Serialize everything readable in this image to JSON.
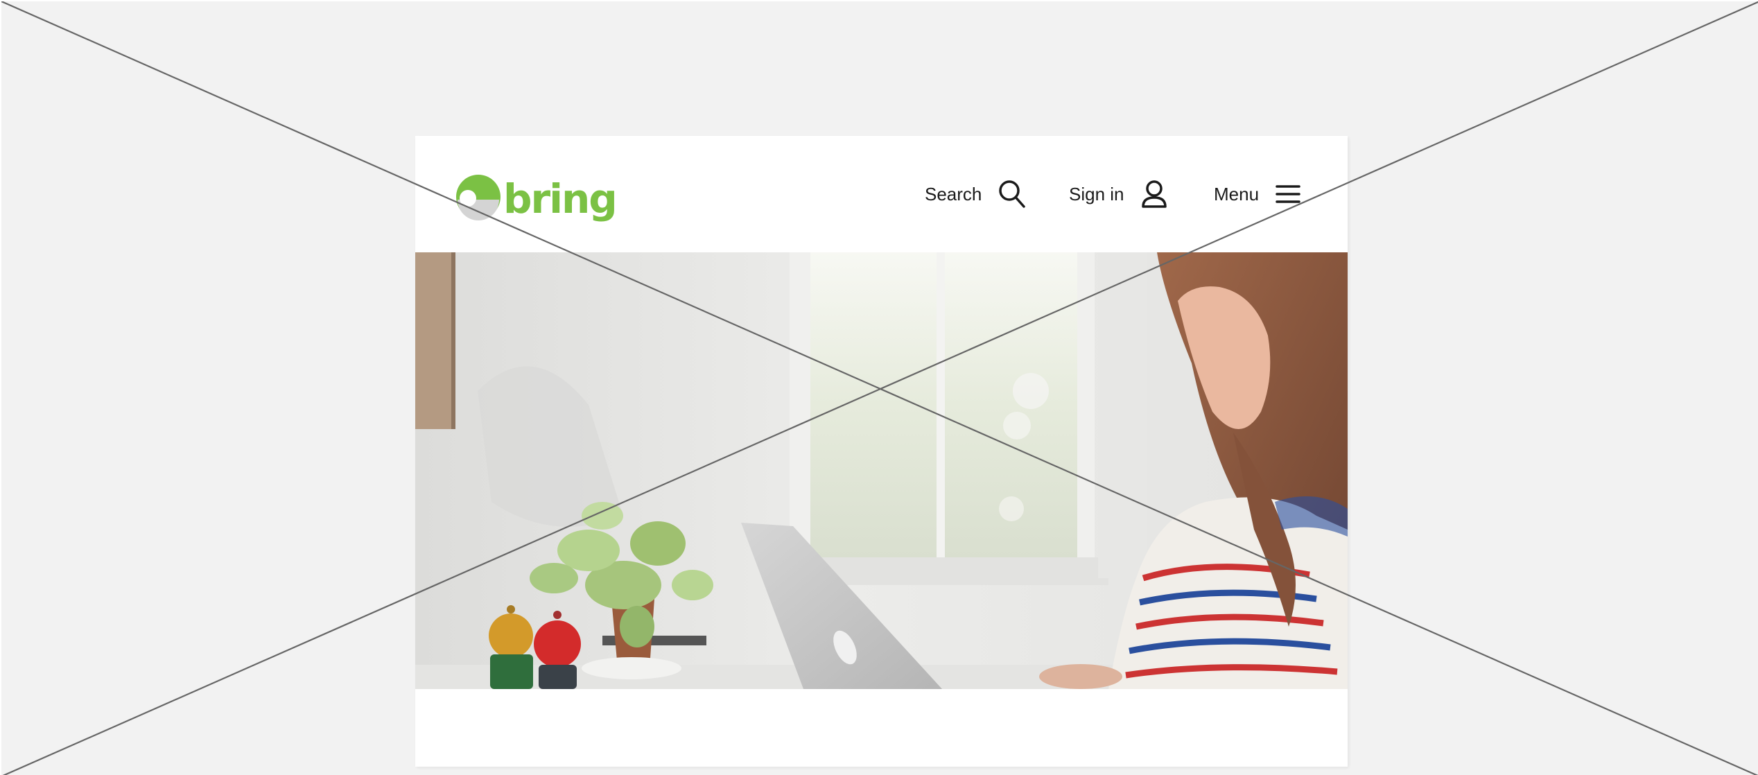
{
  "header": {
    "logo_text": "bring",
    "search_label": "Search",
    "signin_label": "Sign in",
    "menu_label": "Menu"
  },
  "icons": {
    "logo_mark": "bring-circle-logo",
    "search": "search-icon",
    "signin": "user-icon",
    "menu": "hamburger-menu-icon"
  },
  "hero": {
    "image": "woman-working-on-laptop-photo"
  },
  "colors": {
    "brand_green": "#7bc144",
    "page_background": "#f2f2f2",
    "card_background": "#ffffff",
    "text": "#1a1a1a"
  }
}
